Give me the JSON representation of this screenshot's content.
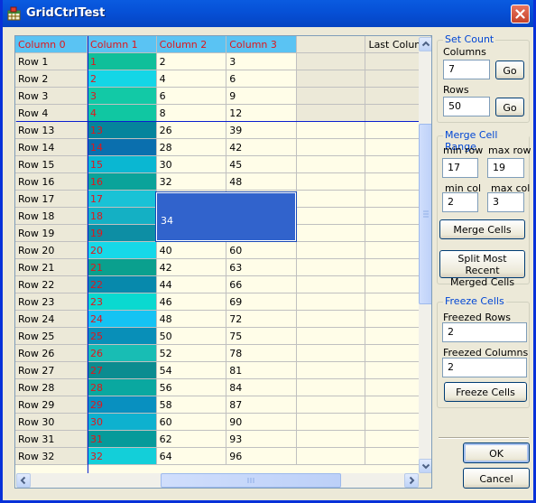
{
  "window": {
    "title": "GridCtrlTest"
  },
  "grid": {
    "column_headers": [
      "Column 0",
      "Column 1",
      "Column 2",
      "Column 3",
      "",
      "Last Column"
    ],
    "frozen_rows": [
      {
        "label": "Row 1",
        "c1": "1",
        "c2": "2",
        "c3": "3"
      },
      {
        "label": "Row 2",
        "c1": "2",
        "c2": "4",
        "c3": "6"
      },
      {
        "label": "Row 3",
        "c1": "3",
        "c2": "6",
        "c3": "9"
      },
      {
        "label": "Row 4",
        "c1": "4",
        "c2": "8",
        "c3": "12"
      }
    ],
    "rows": [
      {
        "label": "Row 13",
        "c1": "13",
        "c2": "26",
        "c3": "39"
      },
      {
        "label": "Row 14",
        "c1": "14",
        "c2": "28",
        "c3": "42"
      },
      {
        "label": "Row 15",
        "c1": "15",
        "c2": "30",
        "c3": "45"
      },
      {
        "label": "Row 16",
        "c1": "16",
        "c2": "32",
        "c3": "48"
      },
      {
        "label": "Row 17",
        "c1": "17",
        "c2": "",
        "c3": ""
      },
      {
        "label": "Row 18",
        "c1": "18",
        "c2": "",
        "c3": ""
      },
      {
        "label": "Row 19",
        "c1": "19",
        "c2": "",
        "c3": ""
      },
      {
        "label": "Row 20",
        "c1": "20",
        "c2": "40",
        "c3": "60"
      },
      {
        "label": "Row 21",
        "c1": "21",
        "c2": "42",
        "c3": "63"
      },
      {
        "label": "Row 22",
        "c1": "22",
        "c2": "44",
        "c3": "66"
      },
      {
        "label": "Row 23",
        "c1": "23",
        "c2": "46",
        "c3": "69"
      },
      {
        "label": "Row 24",
        "c1": "24",
        "c2": "48",
        "c3": "72"
      },
      {
        "label": "Row 25",
        "c1": "25",
        "c2": "50",
        "c3": "75"
      },
      {
        "label": "Row 26",
        "c1": "26",
        "c2": "52",
        "c3": "78"
      },
      {
        "label": "Row 27",
        "c1": "27",
        "c2": "54",
        "c3": "81"
      },
      {
        "label": "Row 28",
        "c1": "28",
        "c2": "56",
        "c3": "84"
      },
      {
        "label": "Row 29",
        "c1": "29",
        "c2": "58",
        "c3": "87"
      },
      {
        "label": "Row 30",
        "c1": "30",
        "c2": "60",
        "c3": "90"
      },
      {
        "label": "Row 31",
        "c1": "31",
        "c2": "62",
        "c3": "93"
      },
      {
        "label": "Row 32",
        "c1": "32",
        "c2": "64",
        "c3": "96"
      }
    ],
    "merged_cell_value": "34",
    "column1_colors": [
      "#0fbf9a",
      "#14d6e6",
      "#12c9a6",
      "#10c7a2",
      "#05849c",
      "#0a6fae",
      "#0ab7d2",
      "#0aa39a",
      "#19c2d6",
      "#14b0c4",
      "#0d8ea4",
      "#16d8e8",
      "#0aa08e",
      "#0789ac",
      "#0ad9d0",
      "#15c3f3",
      "#088fb8",
      "#18bdb4",
      "#0b8c90",
      "#0aa8a0",
      "#0890c0",
      "#0eb1cf",
      "#069a9a",
      "#13cfd9"
    ],
    "header_color": "#5ac3f3",
    "header_text_color": "#e0161b",
    "cell_background": "#fffde8",
    "merged_color": "#3163cc"
  },
  "set_count": {
    "legend": "Set Count",
    "columns_label": "Columns",
    "columns_value": "7",
    "rows_label": "Rows",
    "rows_value": "50",
    "go_label": "Go"
  },
  "merge_range": {
    "legend": "Merge Cell Range",
    "min_row_label": "min row",
    "max_row_label": "max row",
    "min_row_value": "17",
    "max_row_value": "19",
    "min_col_label": "min col",
    "max_col_label": "max col",
    "min_col_value": "2",
    "max_col_value": "3",
    "merge_button": "Merge Cells",
    "split_button_line1": "Split Most Recent",
    "split_button_line2": "Merged Cells"
  },
  "freeze": {
    "legend": "Freeze Cells",
    "rows_label": "Freezed Rows",
    "rows_value": "2",
    "cols_label": "Freezed Columns",
    "cols_value": "2",
    "button": "Freeze Cells"
  },
  "dialog_buttons": {
    "ok": "OK",
    "cancel": "Cancel"
  },
  "icons": {
    "app": "grid-app-icon",
    "close": "close-icon"
  }
}
